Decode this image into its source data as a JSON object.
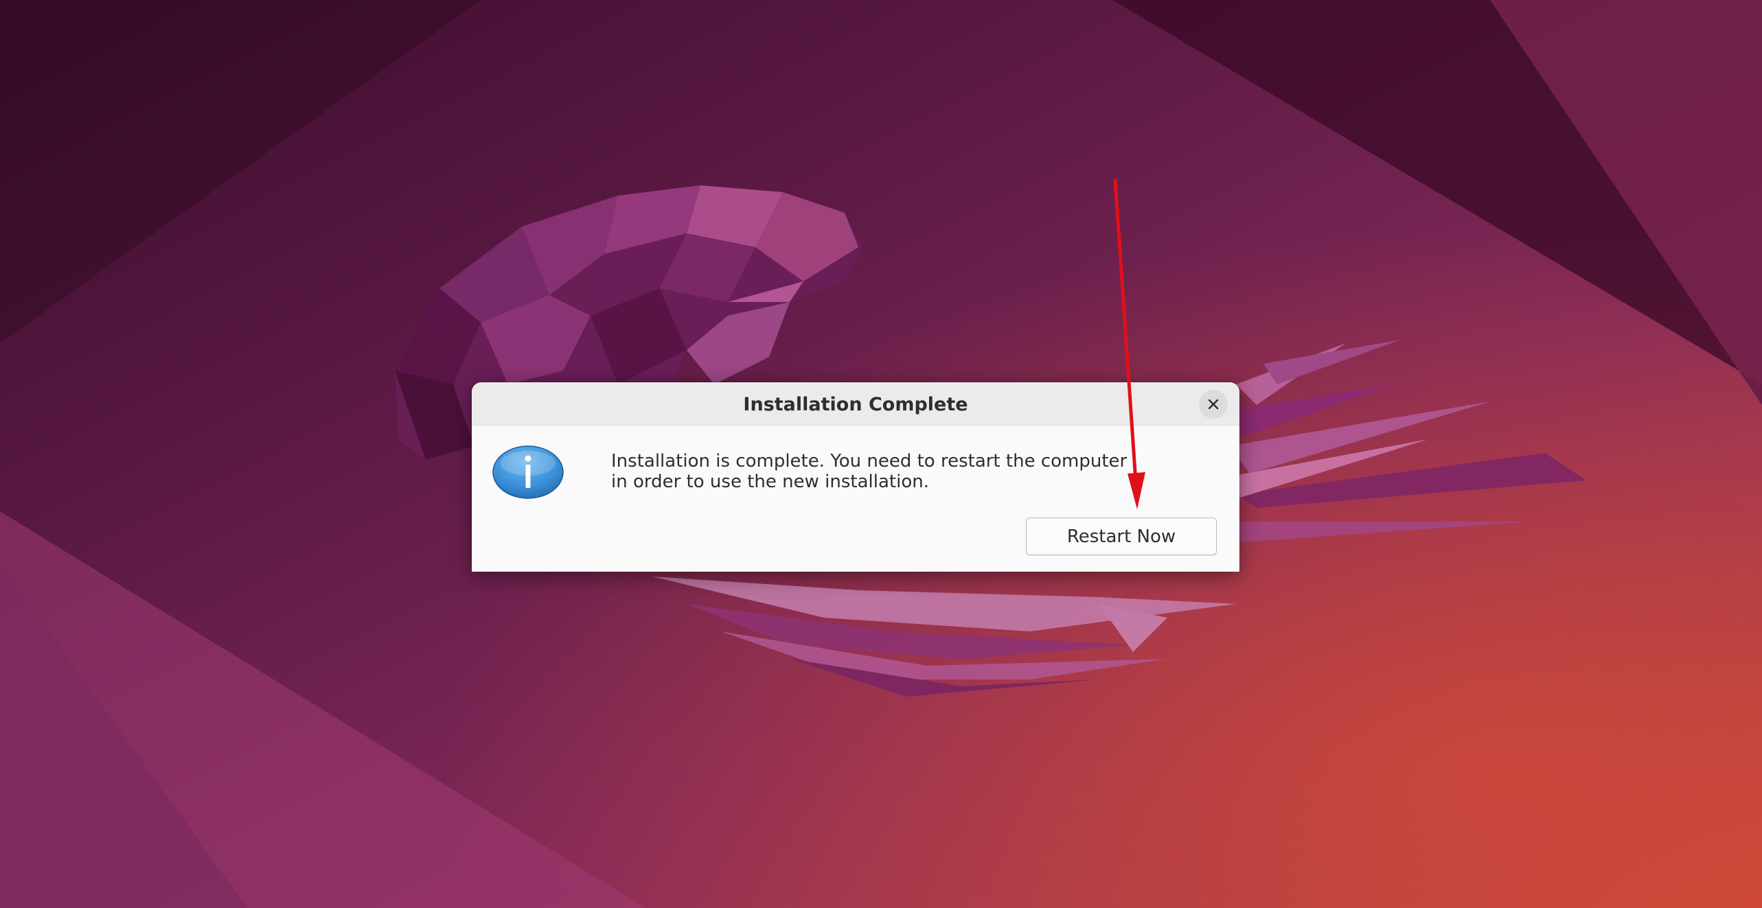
{
  "colors": {
    "wallpaper_dark": "#3a0c2b",
    "wallpaper_mid": "#7a2657",
    "wallpaper_orange": "#c8463a",
    "dialog_bg": "#fafafa",
    "titlebar_bg": "#ebebeb",
    "info_icon_blue": "#3a8fd8",
    "annotation_arrow": "#e0101a"
  },
  "dialog": {
    "title": "Installation Complete",
    "close_icon": "close-icon",
    "info_icon": "information-icon",
    "message_line1": "Installation is complete. You need to restart the computer",
    "message_line2": "in order to use the new installation.",
    "restart_label": "Restart Now"
  },
  "annotation": {
    "icon": "red-arrow-pointing-at-restart-button"
  }
}
